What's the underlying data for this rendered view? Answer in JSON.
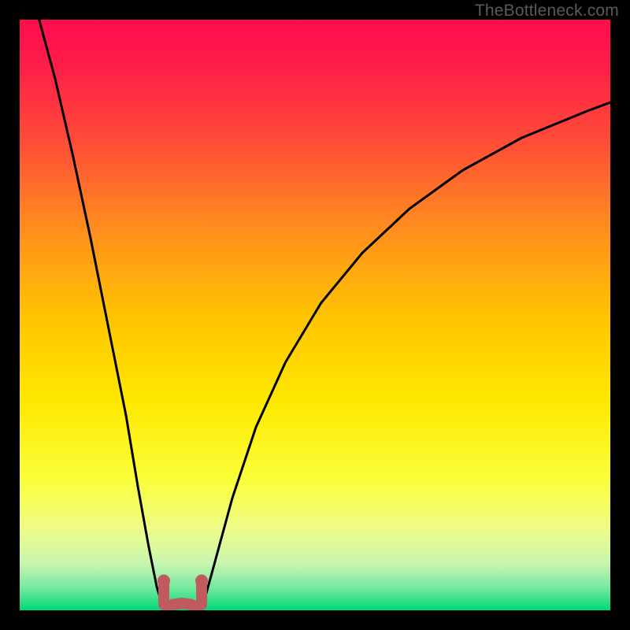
{
  "watermark": "TheBottleneck.com",
  "chart_data": {
    "type": "line",
    "title": "",
    "xlabel": "",
    "ylabel": "",
    "xlim": [
      0,
      1
    ],
    "ylim": [
      0,
      1
    ],
    "series": [
      {
        "name": "left-branch",
        "x": [
          0.033,
          0.06,
          0.09,
          0.12,
          0.15,
          0.18,
          0.2,
          0.218,
          0.232,
          0.244
        ],
        "y": [
          1.0,
          0.9,
          0.77,
          0.63,
          0.48,
          0.33,
          0.21,
          0.11,
          0.04,
          0.0
        ]
      },
      {
        "name": "basin",
        "x": [
          0.244,
          0.25,
          0.26,
          0.275,
          0.29,
          0.3,
          0.308
        ],
        "y": [
          0.0,
          0.005,
          0.01,
          0.012,
          0.01,
          0.005,
          0.0
        ]
      },
      {
        "name": "right-branch",
        "x": [
          0.308,
          0.33,
          0.36,
          0.4,
          0.45,
          0.51,
          0.58,
          0.66,
          0.75,
          0.85,
          0.96,
          1.0
        ],
        "y": [
          0.0,
          0.08,
          0.19,
          0.31,
          0.42,
          0.52,
          0.605,
          0.68,
          0.745,
          0.8,
          0.845,
          0.86
        ]
      }
    ],
    "colors": {
      "curve": "#000000",
      "thick_basin": "#bf5a5f",
      "gradient_stops": [
        {
          "pos": 0.0,
          "color": "#ff0d4f"
        },
        {
          "pos": 0.08,
          "color": "#ff1e48"
        },
        {
          "pos": 0.2,
          "color": "#ff4a38"
        },
        {
          "pos": 0.35,
          "color": "#ff8c1f"
        },
        {
          "pos": 0.5,
          "color": "#ffc300"
        },
        {
          "pos": 0.65,
          "color": "#ffe900"
        },
        {
          "pos": 0.78,
          "color": "#faff3a"
        },
        {
          "pos": 0.86,
          "color": "#eefc86"
        },
        {
          "pos": 0.92,
          "color": "#c9f6b0"
        },
        {
          "pos": 0.96,
          "color": "#7be9a0"
        },
        {
          "pos": 1.0,
          "color": "#00d979"
        }
      ]
    }
  }
}
